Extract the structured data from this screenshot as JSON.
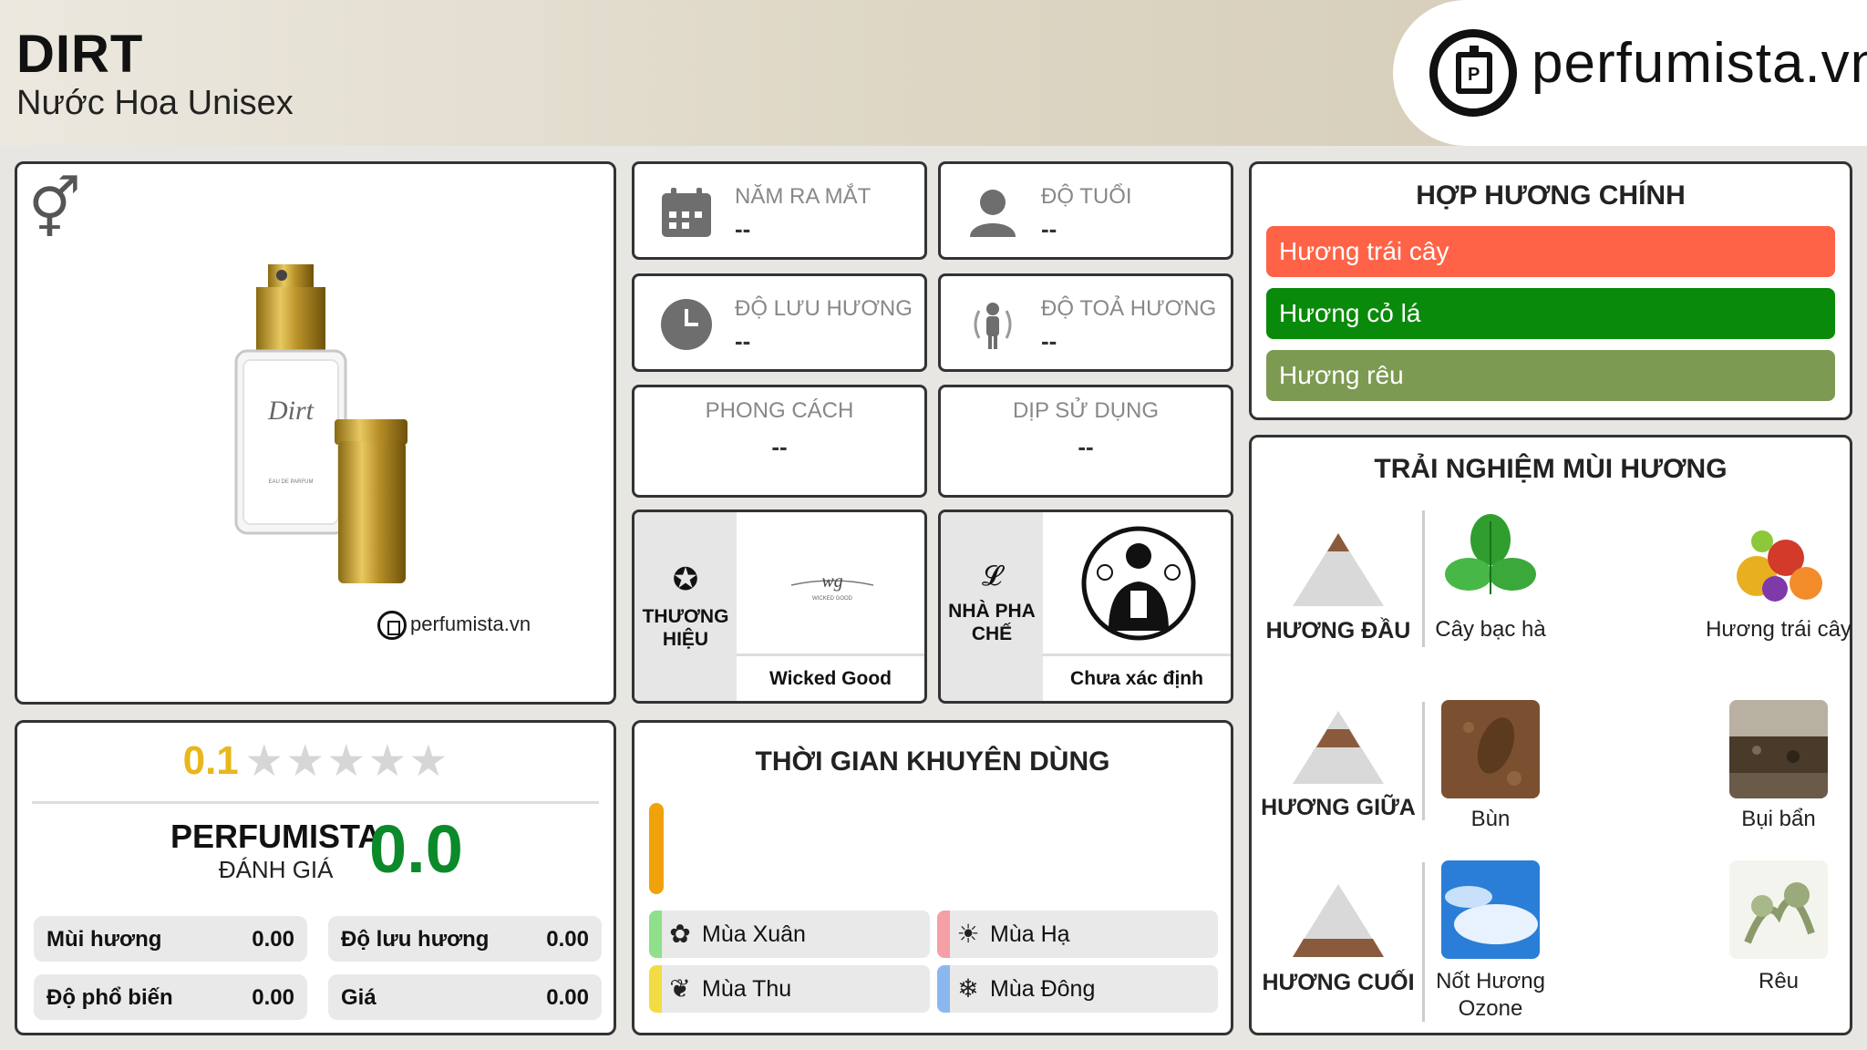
{
  "header": {
    "title": "DIRT",
    "subtitle": "Nước Hoa Unisex",
    "logo_text": "perfumista.vn"
  },
  "product": {
    "gender_icon": "unisex-gender-icon",
    "watermark": "perfumista.vn",
    "bottle_label": "Dirt"
  },
  "info": {
    "release_year": {
      "label": "NĂM RA MẮT",
      "value": "--",
      "icon": "calendar-icon"
    },
    "age": {
      "label": "ĐỘ TUỔI",
      "value": "--",
      "icon": "person-icon"
    },
    "longevity": {
      "label": "ĐỘ LƯU HƯƠNG",
      "value": "--",
      "icon": "clock-icon"
    },
    "sillage": {
      "label": "ĐỘ TOẢ HƯƠNG",
      "value": "--",
      "icon": "sillage-icon"
    },
    "style": {
      "label": "PHONG CÁCH",
      "value": "--"
    },
    "occasion": {
      "label": "DỊP SỬ DỤNG",
      "value": "--"
    }
  },
  "brand": {
    "label": "THƯƠNG HIỆU",
    "name": "Wicked Good",
    "logo_text": "WICKED GOOD"
  },
  "perfumer": {
    "label": "NHÀ PHA CHẾ",
    "name": "Chưa xác định"
  },
  "rating": {
    "user_score": "0.1",
    "stars_filled": 0.1,
    "stars_total": 5,
    "pf_label_a": "PERFUMISTA",
    "pf_label_b": "ĐÁNH GIÁ",
    "pf_score": "0.0",
    "metrics": [
      {
        "label": "Mùi hương",
        "value": "0.00"
      },
      {
        "label": "Độ lưu hương",
        "value": "0.00"
      },
      {
        "label": "Độ phổ biến",
        "value": "0.00"
      },
      {
        "label": "Giá",
        "value": "0.00"
      }
    ]
  },
  "usage": {
    "title": "THỜI GIAN KHUYÊN DÙNG",
    "seasons": [
      {
        "label": "Mùa Xuân",
        "icon": "flower-icon",
        "color": "#8ee08a"
      },
      {
        "label": "Mùa Hạ",
        "icon": "sun-icon",
        "color": "#f4a0a6"
      },
      {
        "label": "Mùa Thu",
        "icon": "leaf-icon",
        "color": "#f2dc43"
      },
      {
        "label": "Mùa Đông",
        "icon": "snowflake-icon",
        "color": "#8ab8ee"
      }
    ]
  },
  "accords": {
    "title": "HỢP HƯƠNG CHÍNH",
    "items": [
      {
        "label": "Hương trái cây",
        "color": "#ff6347"
      },
      {
        "label": "Hương cỏ lá",
        "color": "#0a8a0a"
      },
      {
        "label": "Hương rêu",
        "color": "#7d9a52"
      }
    ],
    "bar_widths": [
      1.0,
      1.0,
      1.0
    ]
  },
  "notes": {
    "title": "TRẢI NGHIỆM MÙI HƯƠNG",
    "top": {
      "label": "HƯƠNG ĐẦU",
      "items": [
        {
          "name": "Cây bạc hà",
          "icon": "mint-image"
        },
        {
          "name": "Hương trái cây",
          "icon": "fruit-image"
        }
      ]
    },
    "middle": {
      "label": "HƯƠNG GIỮA",
      "items": [
        {
          "name": "Bùn",
          "icon": "mud-image"
        },
        {
          "name": "Bụi bẩn",
          "icon": "dirt-image"
        }
      ]
    },
    "base": {
      "label": "HƯƠNG CUỐI",
      "items": [
        {
          "name": "Nốt Hương Ozone",
          "icon": "sky-image"
        },
        {
          "name": "Rêu",
          "icon": "moss-image"
        }
      ]
    }
  },
  "colors": {
    "accent_gold": "#e8b71c",
    "score_green": "#0b8a2a",
    "bar_orange": "#f0a20a"
  }
}
